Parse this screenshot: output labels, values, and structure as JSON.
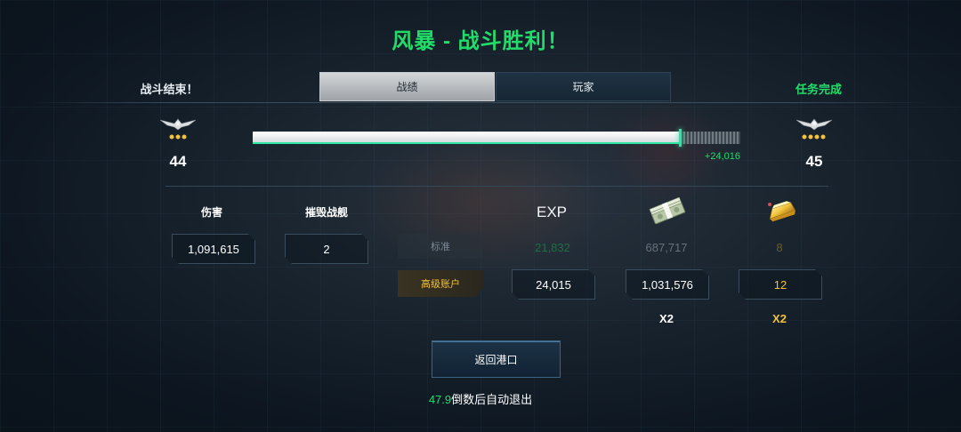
{
  "title": "风暴 - 战斗胜利！",
  "header": {
    "battle_status": "战斗结束！",
    "mission_status": "任务完成",
    "tabs": [
      {
        "label": "战绩",
        "active": true
      },
      {
        "label": "玩家",
        "active": false
      }
    ]
  },
  "progress": {
    "current_level": "44",
    "next_level": "45",
    "exp_gain": "+24,016",
    "fill_fraction": 0.877
  },
  "stats": {
    "damage_label": "伤害",
    "damage_value": "1,091,615",
    "kills_label": "摧毁战舰",
    "kills_value": "2"
  },
  "rewards": {
    "exp_header": "EXP",
    "credits_icon": "money-stack-icon",
    "gold_icon": "gold-bar-icon",
    "standard": {
      "label": "标准",
      "exp": "21,832",
      "credits": "687,717",
      "gold": "8"
    },
    "premium": {
      "label": "高级账户",
      "exp": "24,015",
      "credits": "1,031,576",
      "gold": "12"
    },
    "credits_multiplier": "X2",
    "gold_multiplier": "X2"
  },
  "footer": {
    "return_button": "返回港口",
    "countdown": "47.9",
    "countdown_suffix": "倒数后自动退出"
  },
  "colors": {
    "accent_green": "#22dc6a",
    "gold": "#f2c23a",
    "progress_edge": "#2ee6a4"
  }
}
